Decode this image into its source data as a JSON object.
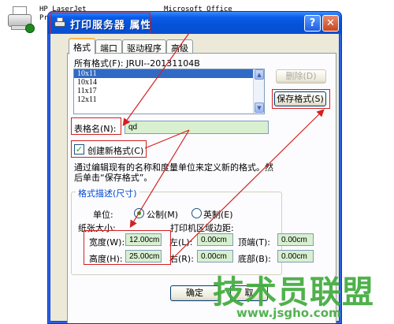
{
  "background": {
    "printer_icon": "printer-icon",
    "text_printer_name_line1": "HP LaserJet",
    "text_printer_name_line2": "Prof",
    "text_office": "Microsoft Office"
  },
  "window": {
    "title": "打印服务器 属性",
    "help_label": "?",
    "close_label": "✕",
    "tabs": [
      {
        "label": "格式",
        "active": true
      },
      {
        "label": "端口",
        "active": false
      },
      {
        "label": "驱动程序",
        "active": false
      },
      {
        "label": "高级",
        "active": false
      }
    ]
  },
  "formats": {
    "all_formats_label": "所有格式(F): JRUI--20131104B",
    "list_items": [
      "10x11",
      "10x14",
      "11x17",
      "12x11"
    ],
    "delete_button": "删除(D)",
    "save_button": "保存格式(S)",
    "form_name_label": "表格名(N):",
    "form_name_value": "qd",
    "create_new_label": "创建新格式(C)",
    "create_new_checked": true,
    "description_line1": "通过编辑现有的名称和度量单位来定义新的格式。然",
    "description_line2": "后单击“保存格式”。"
  },
  "format_desc": {
    "group_title": "格式描述(尺寸)",
    "unit_label": "单位:",
    "metric_label": "公制(M)",
    "imperial_label": "英制(E)",
    "metric_selected": true,
    "paper_size_label": "纸张大小:",
    "margins_label": "打印机区域边距:",
    "width_label": "宽度(W):",
    "width_value": "12.00cm",
    "height_label": "高度(H):",
    "height_value": "25.00cm",
    "left_label": "左(L):",
    "left_value": "0.00cm",
    "right_label": "右(R):",
    "right_value": "0.00cm",
    "top_label": "顶端(T):",
    "top_value": "0.00cm",
    "bottom_label": "底部(B):",
    "bottom_value": "0.00cm"
  },
  "footer": {
    "ok_button": "确定",
    "cancel_partial": "取"
  },
  "watermark": {
    "brand": "技术员联盟",
    "url": "www.jsgho.com"
  },
  "colors": {
    "titlebar": "#0a5ce8",
    "highlight": "#d42020",
    "field_bg": "#d8f0d0",
    "watermark": "#40aa3c"
  }
}
